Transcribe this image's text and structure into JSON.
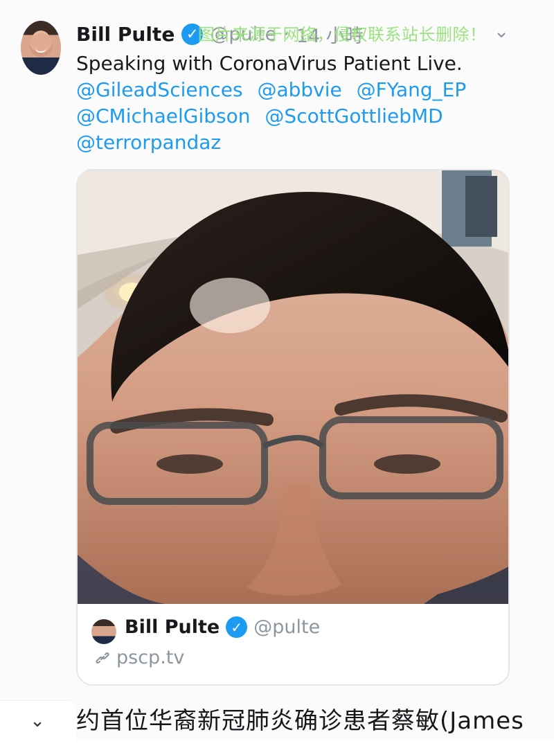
{
  "tweet": {
    "author": {
      "name": "Bill Pulte",
      "handle": "@pulte",
      "time": "14 小時",
      "avatar_icon": "profile-photo"
    },
    "text": "Speaking with CoronaVirus Patient Live.",
    "mentions": [
      "@GileadSciences",
      "@abbvie",
      "@FYang_EP",
      "@CMichaelGibson",
      "@ScottGottliebMD",
      "@terrorpandaz"
    ],
    "menu_icon": "chevron-down-icon",
    "watermark": "图片来源于网络，侵权联系站长删除！"
  },
  "card": {
    "author_name": "Bill Pulte",
    "handle": "@pulte",
    "link": "pscp.tv",
    "link_icon": "link-icon",
    "video_icon": "video-frame"
  },
  "caption": {
    "text": "约首位华裔新冠肺炎确诊患者蔡敏(James"
  },
  "colors": {
    "verified_blue": "#1d9bf0",
    "mention_blue": "#1d9bf0",
    "muted_gray": "#8d969e",
    "watermark_green": "#7edb5e"
  }
}
